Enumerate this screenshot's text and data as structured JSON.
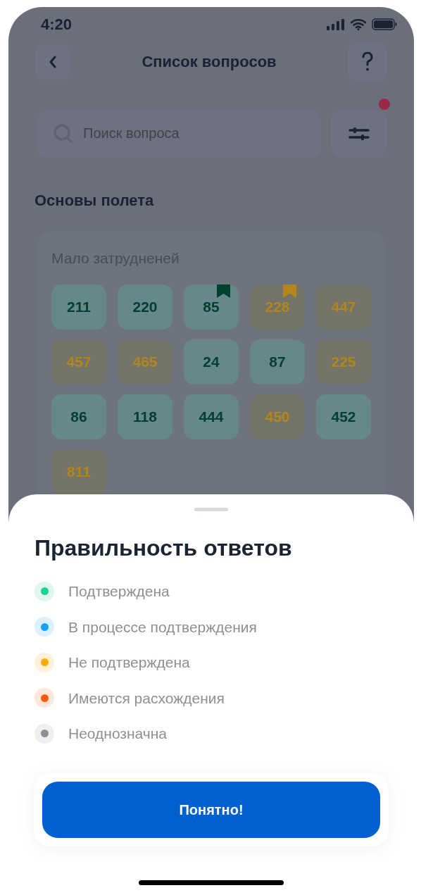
{
  "status_bar": {
    "time": "4:20"
  },
  "header": {
    "title": "Список вопросов"
  },
  "search": {
    "placeholder": "Поиск вопроса"
  },
  "filter": {
    "has_notification": true
  },
  "section": {
    "title": "Основы полета",
    "card": {
      "label": "Мало затрудненей",
      "tiles": [
        {
          "number": "211",
          "kind": "confirmed",
          "bookmarked": false
        },
        {
          "number": "220",
          "kind": "confirmed",
          "bookmarked": false
        },
        {
          "number": "85",
          "kind": "confirmed",
          "bookmarked": true
        },
        {
          "number": "228",
          "kind": "unconfirmed",
          "bookmarked": true
        },
        {
          "number": "447",
          "kind": "unconfirmed",
          "bookmarked": false
        },
        {
          "number": "457",
          "kind": "unconfirmed",
          "bookmarked": false
        },
        {
          "number": "465",
          "kind": "unconfirmed",
          "bookmarked": false
        },
        {
          "number": "24",
          "kind": "confirmed",
          "bookmarked": false
        },
        {
          "number": "87",
          "kind": "confirmed",
          "bookmarked": false
        },
        {
          "number": "225",
          "kind": "unconfirmed",
          "bookmarked": false
        },
        {
          "number": "86",
          "kind": "confirmed",
          "bookmarked": false
        },
        {
          "number": "118",
          "kind": "confirmed",
          "bookmarked": false
        },
        {
          "number": "444",
          "kind": "confirmed",
          "bookmarked": false
        },
        {
          "number": "450",
          "kind": "unconfirmed",
          "bookmarked": false
        },
        {
          "number": "452",
          "kind": "confirmed",
          "bookmarked": false
        },
        {
          "number": "811",
          "kind": "unconfirmed",
          "bookmarked": false
        }
      ]
    }
  },
  "sheet": {
    "title": "Правильность ответов",
    "legend": [
      {
        "label": "Подтверждена",
        "color": "#1fd195"
      },
      {
        "label": "В процессе подтверждения",
        "color": "#14a3ff"
      },
      {
        "label": "Не подтверждена",
        "color": "#ffaa00"
      },
      {
        "label": "Имеются расхождения",
        "color": "#ff5a0a"
      },
      {
        "label": "Неоднозначна",
        "color": "#8a9196"
      }
    ],
    "button": "Понятно!"
  }
}
